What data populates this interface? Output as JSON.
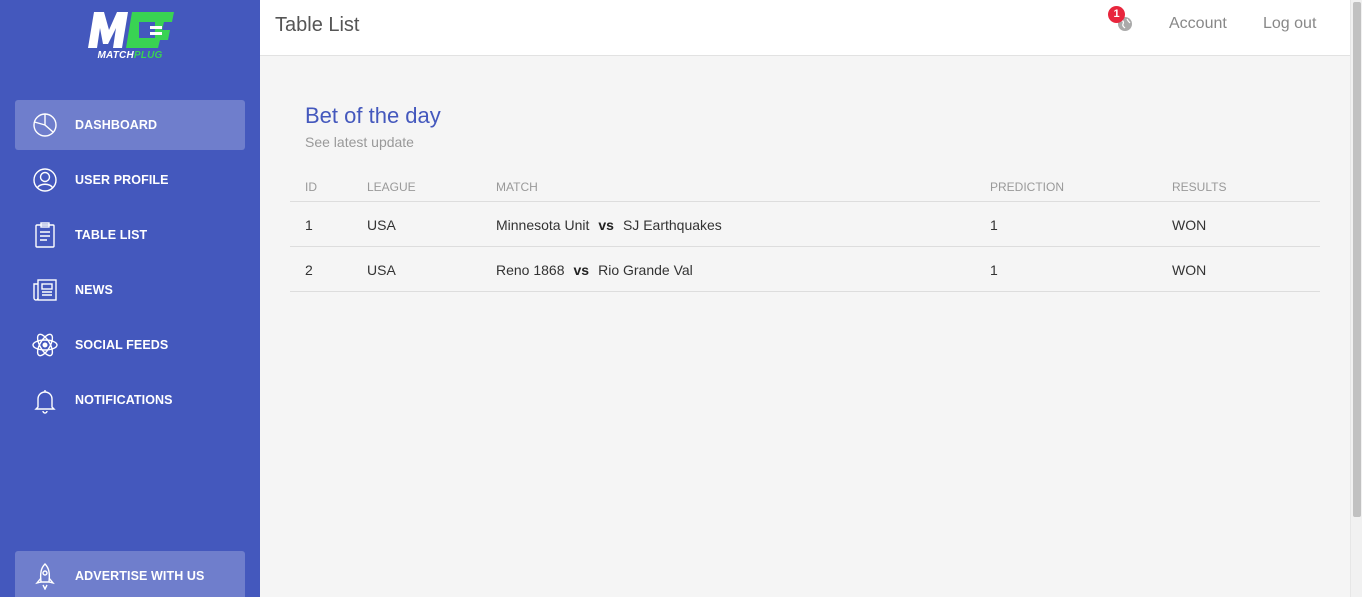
{
  "brand": {
    "logo_letters": "MP",
    "name_part1": "MATCH",
    "name_part2": "PLUG",
    "primary_color": "#4458bd",
    "accent_color": "#39d353"
  },
  "sidebar": {
    "items": [
      {
        "label": "DASHBOARD",
        "icon": "pie-chart-icon",
        "active": true
      },
      {
        "label": "USER PROFILE",
        "icon": "user-icon",
        "active": false
      },
      {
        "label": "TABLE LIST",
        "icon": "clipboard-icon",
        "active": false
      },
      {
        "label": "NEWS",
        "icon": "newspaper-icon",
        "active": false
      },
      {
        "label": "SOCIAL FEEDS",
        "icon": "atom-icon",
        "active": false
      },
      {
        "label": "NOTIFICATIONS",
        "icon": "bell-icon",
        "active": false
      }
    ],
    "advertise": {
      "label": "ADVERTISE WITH US",
      "icon": "rocket-icon"
    }
  },
  "header": {
    "title": "Table List",
    "notification_count": "1",
    "account_label": "Account",
    "logout_label": "Log out"
  },
  "card": {
    "title": "Bet of the day",
    "subtitle": "See latest update"
  },
  "table": {
    "columns": [
      "ID",
      "LEAGUE",
      "MATCH",
      "PREDICTION",
      "RESULTS"
    ],
    "vs_label": "vs",
    "rows": [
      {
        "id": "1",
        "league": "USA",
        "home": "Minnesota Unit",
        "away": "SJ Earthquakes",
        "prediction": "1",
        "result": "WON"
      },
      {
        "id": "2",
        "league": "USA",
        "home": "Reno 1868",
        "away": "Rio Grande Val",
        "prediction": "1",
        "result": "WON"
      }
    ]
  }
}
